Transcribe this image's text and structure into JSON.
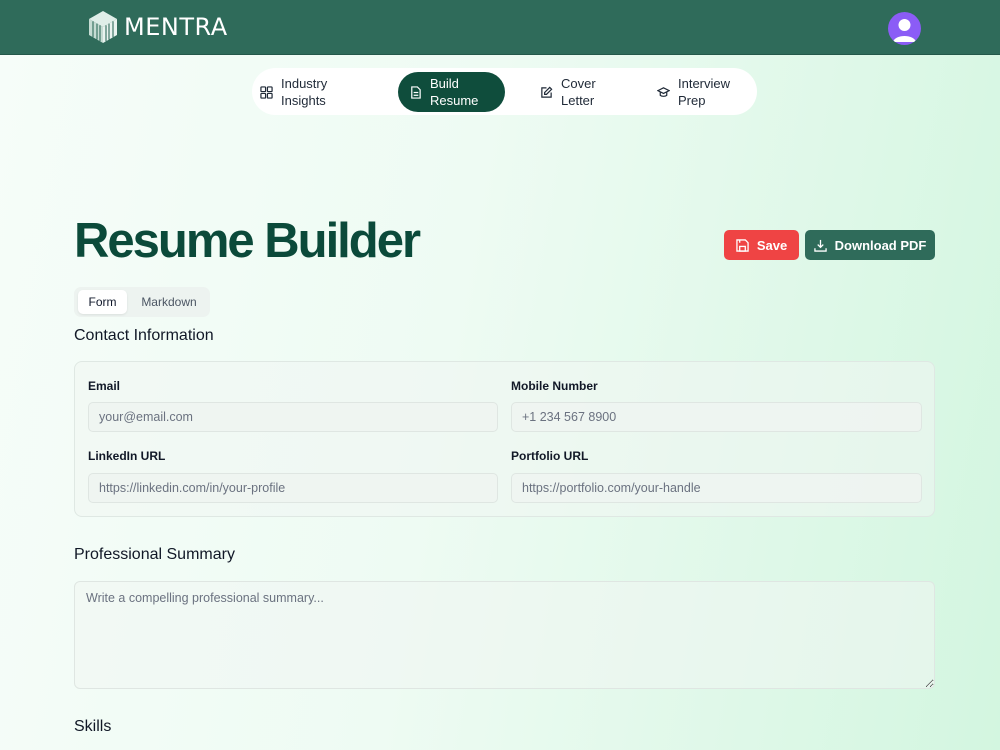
{
  "brand": {
    "name": "MENTRA",
    "logo_icon": "cube-logo-icon"
  },
  "user": {
    "avatar_icon": "user-avatar-icon",
    "avatar_color": "#8b5cf6"
  },
  "nav": {
    "items": [
      {
        "label": "Industry Insights",
        "icon": "dashboard-icon",
        "active": false
      },
      {
        "label": "Build Resume",
        "icon": "document-icon",
        "active": true
      },
      {
        "label": "Cover Letter",
        "icon": "pen-square-icon",
        "active": false
      },
      {
        "label": "Interview Prep",
        "icon": "graduation-cap-icon",
        "active": false
      }
    ]
  },
  "page": {
    "title": "Resume Builder"
  },
  "actions": {
    "save_label": "Save",
    "download_label": "Download PDF",
    "save_color": "#ef4444",
    "download_color": "#2f6b5a"
  },
  "mode_tabs": {
    "form": "Form",
    "markdown": "Markdown",
    "active": "Form"
  },
  "contact": {
    "title": "Contact Information",
    "email": {
      "label": "Email",
      "placeholder": "your@email.com",
      "value": ""
    },
    "mobile": {
      "label": "Mobile Number",
      "placeholder": "+1 234 567 8900",
      "value": ""
    },
    "linkedin": {
      "label": "LinkedIn URL",
      "placeholder": "https://linkedin.com/in/your-profile",
      "value": ""
    },
    "portfolio": {
      "label": "Portfolio URL",
      "placeholder": "https://portfolio.com/your-handle",
      "value": ""
    }
  },
  "summary": {
    "title": "Professional Summary",
    "placeholder": "Write a compelling professional summary..."
  },
  "skills": {
    "title": "Skills"
  },
  "colors": {
    "header_bg": "#2f6b5a",
    "accent_dark": "#0f4d3c",
    "title": "#0b4a3a"
  }
}
